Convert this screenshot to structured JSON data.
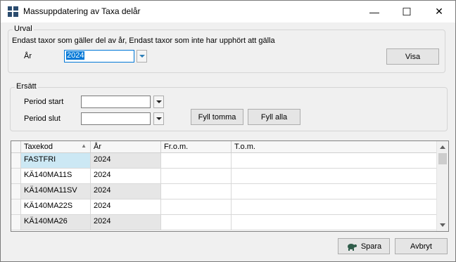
{
  "window": {
    "title": "Massuppdatering av Taxa delår",
    "minimize": "—",
    "maximize": "☐",
    "close": "✕"
  },
  "urval": {
    "legend": "Urval",
    "description": "Endast taxor som gäller del av år, Endast taxor som inte har upphört att gälla",
    "year_label": "År",
    "year_value": "2024",
    "visa_label": "Visa"
  },
  "ersatt": {
    "legend": "Ersätt",
    "period_start_label": "Period start",
    "period_start_value": "",
    "period_slut_label": "Period slut",
    "period_slut_value": "",
    "fyll_tomma_label": "Fyll tomma",
    "fyll_alla_label": "Fyll alla"
  },
  "table": {
    "columns": [
      "Taxekod",
      "År",
      "Fr.o.m.",
      "T.o.m."
    ],
    "rows": [
      [
        "FASTFRI",
        "2024",
        "",
        ""
      ],
      [
        "KÄ140MA11S",
        "2024",
        "",
        ""
      ],
      [
        "KÄ140MA11SV",
        "2024",
        "",
        ""
      ],
      [
        "KÄ140MA22S",
        "2024",
        "",
        ""
      ],
      [
        "KÄ140MA26",
        "2024",
        "",
        ""
      ]
    ]
  },
  "footer": {
    "spara_label": "Spara",
    "avbryt_label": "Avbryt"
  },
  "colors": {
    "selected_cell": "#cce8f4",
    "readonly_cell": "#e6e6e6",
    "title_icon": "#2b4c6f"
  },
  "icons": {
    "app": "grid-app-icon",
    "save": "turtle-save-icon"
  }
}
